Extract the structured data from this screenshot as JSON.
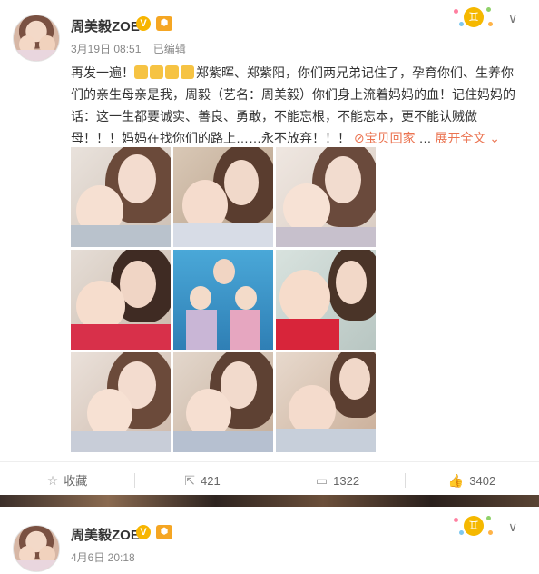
{
  "posts": [
    {
      "author": "周美毅ZOE",
      "verified_badge": "V",
      "member_badge": "⬢",
      "date": "3月19日 08:51",
      "edited": "已编辑",
      "text_before": "再发一遍！",
      "text_after": "郑紫晖、郑紫阳，你们两兄弟记住了，孕育你们、生养你们的亲生母亲是我，周毅（艺名：周美毅）你们身上流着妈妈的血！记住妈妈的话：这一生都要诚实、善良、勇敢，不能忘根，不能忘本，更不能认贼做母！！！妈妈在找你们的路上……永不放弃！！！",
      "link_icon": "⊘",
      "link_text": "宝贝回家",
      "expand_text": "展开全文",
      "expand_icon": "⌄",
      "photo_count": 9,
      "actions": {
        "favorite_label": "收藏",
        "repost_count": "421",
        "comment_count": "1322",
        "like_count": "3402"
      },
      "icons": {
        "favorite": "star-icon",
        "repost": "repost-icon",
        "comment": "comment-icon",
        "like": "thumbs-up-icon",
        "menu": "chevron-down-icon",
        "zodiac": "gemini-icon"
      },
      "zodiac_glyph": "♊",
      "menu_glyph": "∨"
    },
    {
      "author": "周美毅ZOE",
      "verified_badge": "V",
      "member_badge": "⬢",
      "date": "4月6日 20:18",
      "zodiac_glyph": "♊",
      "menu_glyph": "∨"
    }
  ],
  "action_glyphs": {
    "favorite": "☆",
    "repost": "⇱",
    "comment": "▭",
    "like": "👍"
  },
  "colors": {
    "accent": "#eb7350",
    "badge": "#f7b500"
  }
}
